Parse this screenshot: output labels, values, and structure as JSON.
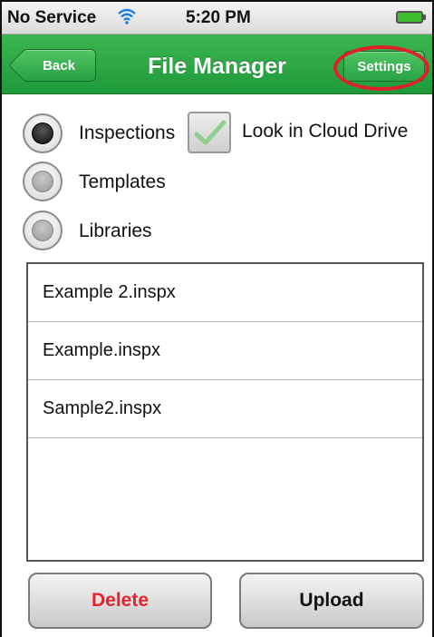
{
  "status_bar": {
    "carrier": "No Service",
    "time": "5:20 PM",
    "wifi_icon": "wifi-icon",
    "battery_icon": "battery-icon",
    "battery_color": "#3dbd2f"
  },
  "nav_bar": {
    "back_label": "Back",
    "title": "File Manager",
    "settings_label": "Settings",
    "color": "#2aa845",
    "highlight_color": "#e0202a"
  },
  "options": {
    "radios": [
      {
        "label": "Inspections",
        "selected": true
      },
      {
        "label": "Templates",
        "selected": false
      },
      {
        "label": "Libraries",
        "selected": false
      }
    ],
    "cloud_checkbox": {
      "label": "Look in Cloud Drive",
      "checked": true,
      "icon": "check-icon"
    }
  },
  "file_list": {
    "items": [
      "Example 2.inspx",
      "Example.inspx",
      "Sample2.inspx"
    ]
  },
  "actions": {
    "delete_label": "Delete",
    "upload_label": "Upload",
    "delete_color": "#e3242b"
  }
}
